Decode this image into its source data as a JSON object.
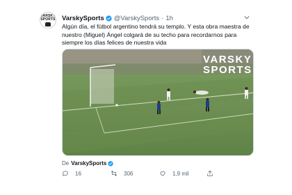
{
  "author": {
    "display_name": "VarskySports",
    "handle": "@VarskySports",
    "separator": "·",
    "time": "1h",
    "avatar_logo": [
      "VARSKY",
      "SPORTS"
    ]
  },
  "tweet": {
    "text": "Algún día, el fútbol argentino tendrá su templo. Y esta obra maestra de nuestro (Miguel) Ángel colgará de su techo para recordarnos para siempre los días felices de nuestra vida"
  },
  "media": {
    "watermark_line1": "VARSKY",
    "watermark_line2": "SPORTS"
  },
  "source": {
    "prefix": "De",
    "name": "VarskySports"
  },
  "actions": {
    "replies": "16",
    "retweets": "306",
    "likes": "1,9 mil"
  },
  "colors": {
    "verified": "#1d9bf0",
    "secondary_text": "#536471",
    "pitch_green": "#6c8f52"
  }
}
